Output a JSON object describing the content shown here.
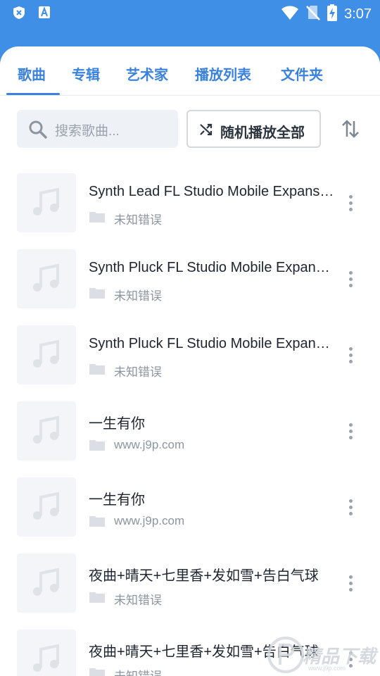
{
  "status_bar": {
    "time": "3:07",
    "left_icons": [
      "shield-x-icon",
      "translate-a-icon"
    ],
    "right_icons": [
      "wifi-icon",
      "no-sim-icon",
      "battery-charging-icon"
    ]
  },
  "tabs": [
    {
      "label": "歌曲",
      "active": true
    },
    {
      "label": "专辑",
      "active": false
    },
    {
      "label": "艺术家",
      "active": false
    },
    {
      "label": "播放列表",
      "active": false
    },
    {
      "label": "文件夹",
      "active": false
    }
  ],
  "toolbar": {
    "search_placeholder": "搜索歌曲...",
    "shuffle_label": "随机播放全部"
  },
  "songs": [
    {
      "title": "Synth Lead FL Studio Mobile Expansion",
      "subtitle": "未知错误"
    },
    {
      "title": "Synth Pluck FL Studio Mobile Expansion",
      "subtitle": "未知错误"
    },
    {
      "title": "Synth Pluck FL Studio Mobile Expansion",
      "subtitle": "未知错误"
    },
    {
      "title": "一生有你",
      "subtitle": "www.j9p.com"
    },
    {
      "title": "一生有你",
      "subtitle": "www.j9p.com"
    },
    {
      "title": "夜曲+晴天+七里香+发如雪+告白气球",
      "subtitle": "未知错误"
    },
    {
      "title": "夜曲+晴天+七里香+发如雪+告白气球",
      "subtitle": "未知错误"
    }
  ],
  "watermark": {
    "text": "精品下载",
    "url": "www.j9p.com"
  },
  "colors": {
    "accent": "#3a82de",
    "status_bar": "#3f8fe6"
  }
}
